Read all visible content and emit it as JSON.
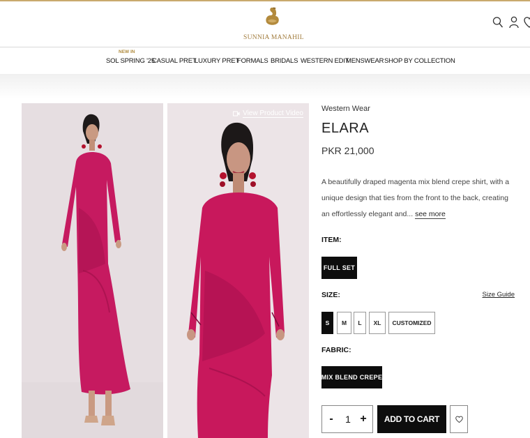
{
  "brand": {
    "name": "SUNNIA MANAHIL",
    "color": "#a07a3a"
  },
  "header_icons": [
    "search-icon",
    "user-icon",
    "heart-icon"
  ],
  "nav": {
    "badge": "NEW IN",
    "items": [
      "SOL SPRING '25",
      "CASUAL PRET",
      "LUXURY PRET",
      "FORMALS",
      "BRIDALS",
      "WESTERN EDIT",
      "MENSWEAR",
      "SHOP BY COLLECTION"
    ]
  },
  "gallery": {
    "video_link": "View Product Video",
    "garment_color": "#c8185c"
  },
  "product": {
    "category": "Western Wear",
    "title": "ELARA",
    "price": "PKR 21,000",
    "description": "A beautifully draped magenta mix blend crepe shirt, with a unique design that ties from the front to the back, creating an effortlessly elegant and...",
    "see_more": "see more"
  },
  "options": {
    "item_label": "ITEM:",
    "item_value": "FULL SET",
    "size_label": "SIZE:",
    "size_guide": "Size Guide",
    "sizes": [
      "S",
      "M",
      "L",
      "XL",
      "CUSTOMIZED"
    ],
    "selected_size": "S",
    "fabric_label": "FABRIC:",
    "fabric_value": "MIX BLEND CREPE"
  },
  "cart": {
    "minus": "-",
    "quantity": "1",
    "plus": "+",
    "add_label": "ADD TO CART"
  }
}
